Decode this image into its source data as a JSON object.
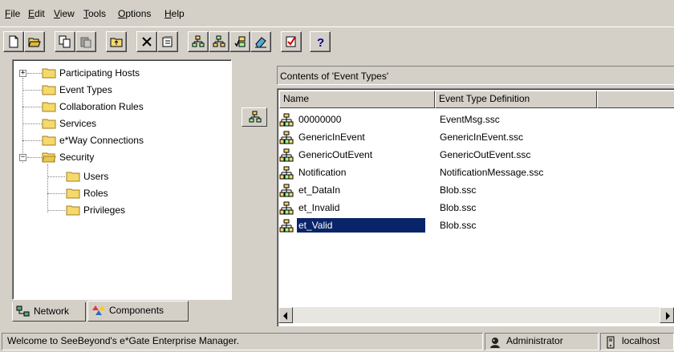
{
  "menubar": {
    "items": [
      {
        "label": "File",
        "u": "F"
      },
      {
        "label": "Edit",
        "u": "E"
      },
      {
        "label": "View",
        "u": "V"
      },
      {
        "label": "Tools",
        "u": "T"
      },
      {
        "label": "Options",
        "u": "O"
      },
      {
        "label": "Help",
        "u": "H"
      }
    ]
  },
  "toolbar": {
    "buttons": [
      "new-icon",
      "open-icon",
      "copy-icon",
      "paste-icon",
      "up-folder-icon",
      "delete-icon",
      "properties-icon",
      "add-node-icon",
      "remove-node-icon",
      "check-node-icon",
      "eraser-icon",
      "checked-doc-icon",
      "help-icon"
    ],
    "help_label": "?"
  },
  "tree": {
    "items": [
      {
        "label": "Participating Hosts",
        "expander": "+"
      },
      {
        "label": "Event Types"
      },
      {
        "label": "Collaboration Rules"
      },
      {
        "label": "Services"
      },
      {
        "label": "e*Way Connections"
      },
      {
        "label": "Security",
        "expander": "−"
      },
      {
        "label": "Users"
      },
      {
        "label": "Roles"
      },
      {
        "label": "Privileges"
      }
    ]
  },
  "tabs": [
    {
      "label": "Network"
    },
    {
      "label": "Components",
      "active": true
    }
  ],
  "right_panel": {
    "header": "Contents of  'Event Types'",
    "columns": [
      "Name",
      "Event Type Definition"
    ],
    "rows": [
      {
        "name": "00000000",
        "definition": "EventMsg.ssc"
      },
      {
        "name": "GenericInEvent",
        "definition": "GenericInEvent.ssc"
      },
      {
        "name": "GenericOutEvent",
        "definition": "GenericOutEvent.ssc"
      },
      {
        "name": "Notification",
        "definition": "NotificationMessage.ssc"
      },
      {
        "name": "et_DataIn",
        "definition": "Blob.ssc"
      },
      {
        "name": "et_Invalid",
        "definition": "Blob.ssc"
      },
      {
        "name": "et_Valid",
        "definition": "Blob.ssc",
        "selected": true
      }
    ]
  },
  "statusbar": {
    "message": "Welcome to SeeBeyond's e*Gate Enterprise Manager.",
    "user": "Administrator",
    "host": "localhost"
  },
  "colors": {
    "face": "#d4d0c8",
    "selection": "#0a246a",
    "folder": "#f5d96b"
  }
}
